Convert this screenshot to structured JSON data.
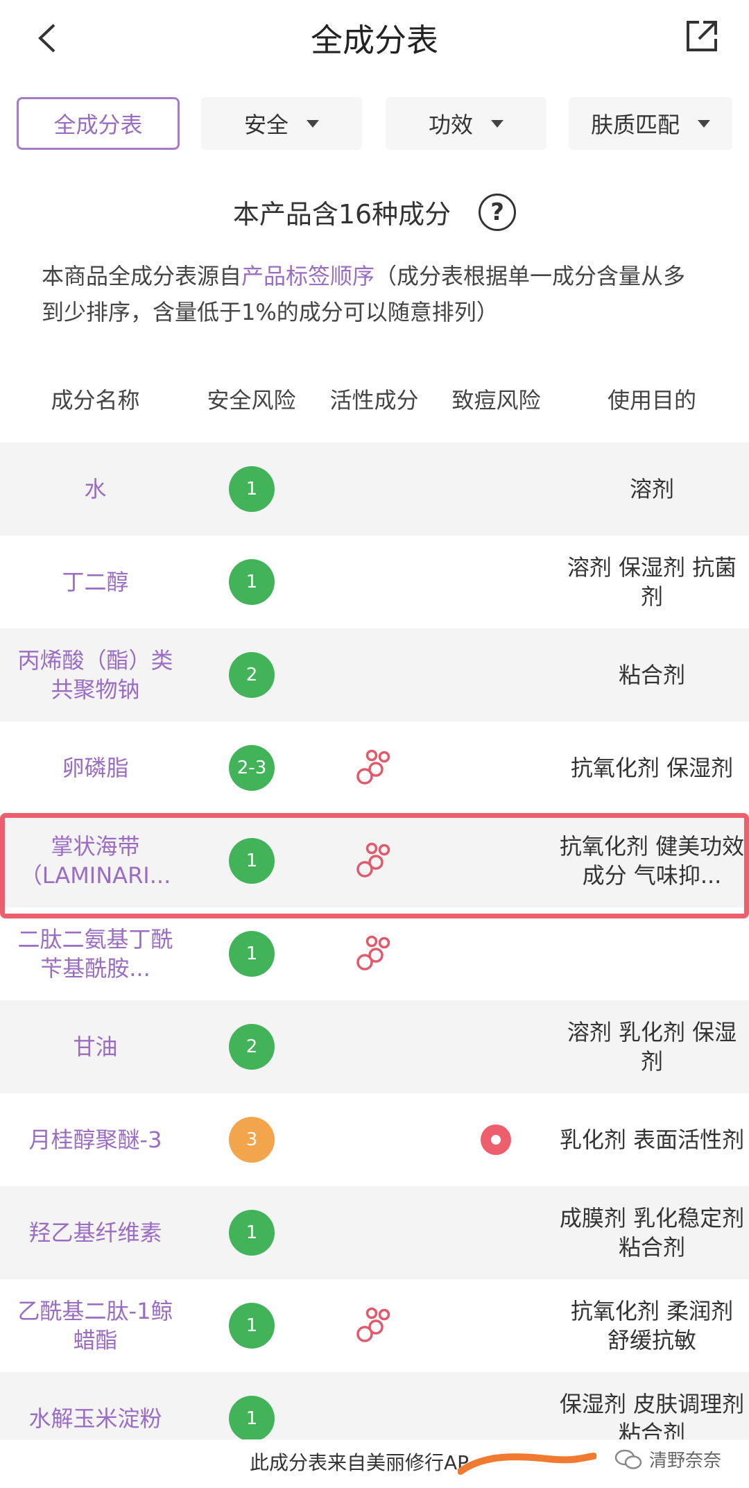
{
  "header": {
    "title": "全成分表"
  },
  "tabs": [
    {
      "label": "全成分表",
      "active": true
    },
    {
      "label": "安全",
      "active": false
    },
    {
      "label": "功效",
      "active": false
    },
    {
      "label": "肤质匹配",
      "active": false
    }
  ],
  "summary": {
    "title": "本产品含16种成分",
    "desc_prefix": "本商品全成分表源自",
    "desc_link": "产品标签顺序",
    "desc_suffix": "（成分表根据单一成分含量从多到少排序，含量低于1%的成分可以随意排列）"
  },
  "columns": [
    "成分名称",
    "安全风险",
    "活性成分",
    "致痘风险",
    "使用目的"
  ],
  "rows": [
    {
      "name": "水",
      "safety": "1",
      "safety_color": "green",
      "active": false,
      "acne": false,
      "purpose": "溶剂"
    },
    {
      "name": "丁二醇",
      "safety": "1",
      "safety_color": "green",
      "active": false,
      "acne": false,
      "purpose": "溶剂 保湿剂 抗菌剂"
    },
    {
      "name": "丙烯酸（酯）类共聚物钠",
      "safety": "2",
      "safety_color": "green",
      "active": false,
      "acne": false,
      "purpose": "粘合剂"
    },
    {
      "name": "卵磷脂",
      "safety": "2-3",
      "safety_color": "green",
      "active": true,
      "acne": false,
      "purpose": "抗氧化剂 保湿剂"
    },
    {
      "name": "掌状海带（LAMINARI...",
      "safety": "1",
      "safety_color": "green",
      "active": true,
      "acne": false,
      "purpose": "抗氧化剂 健美功效成分 气味抑..."
    },
    {
      "name": "二肽二氨基丁酰苄基酰胺...",
      "safety": "1",
      "safety_color": "green",
      "active": true,
      "acne": false,
      "purpose": ""
    },
    {
      "name": "甘油",
      "safety": "2",
      "safety_color": "green",
      "active": false,
      "acne": false,
      "purpose": "溶剂 乳化剂 保湿剂"
    },
    {
      "name": "月桂醇聚醚-3",
      "safety": "3",
      "safety_color": "orange",
      "active": false,
      "acne": true,
      "purpose": "乳化剂 表面活性剂"
    },
    {
      "name": "羟乙基纤维素",
      "safety": "1",
      "safety_color": "green",
      "active": false,
      "acne": false,
      "purpose": "成膜剂 乳化稳定剂 粘合剂"
    },
    {
      "name": "乙酰基二肽-1鲸蜡酯",
      "safety": "1",
      "safety_color": "green",
      "active": true,
      "acne": false,
      "purpose": "抗氧化剂 柔润剂 舒缓抗敏"
    },
    {
      "name": "水解玉米淀粉",
      "safety": "1",
      "safety_color": "green",
      "active": false,
      "acne": false,
      "purpose": "保湿剂 皮肤调理剂 粘合剂"
    }
  ],
  "footer": {
    "source": "此成分表来自美丽修行AP",
    "watermark": "清野奈奈"
  },
  "colors": {
    "accent": "#9a6cc2",
    "safe": "#43b35a",
    "warn": "#f2a54a",
    "acne": "#ee5f6e",
    "highlight": "#ec5f6c"
  }
}
